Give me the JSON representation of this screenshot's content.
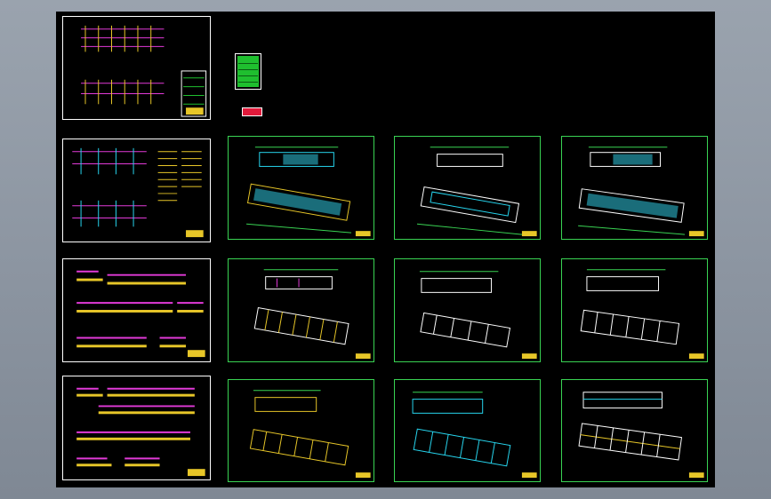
{
  "canvas": {
    "background": "#000000"
  },
  "colors": {
    "sheet_border_white": "#ffffff",
    "sheet_border_green": "#39d353",
    "cyan": "#27d7f0",
    "magenta": "#e23ad8",
    "yellow": "#e7c628",
    "green": "#1fbf2f",
    "red": "#e11a3b",
    "white": "#ffffff"
  },
  "sheets": [
    {
      "id": "electrical-riser-1"
    },
    {
      "id": "electrical-riser-2"
    },
    {
      "id": "section-detail-1"
    },
    {
      "id": "section-detail-2"
    },
    {
      "id": "floor-plan-1"
    },
    {
      "id": "floor-plan-2"
    },
    {
      "id": "floor-plan-3"
    },
    {
      "id": "floor-plan-4"
    },
    {
      "id": "floor-plan-5"
    },
    {
      "id": "floor-plan-6"
    },
    {
      "id": "floor-plan-7"
    },
    {
      "id": "floor-plan-8"
    },
    {
      "id": "floor-plan-9"
    }
  ]
}
